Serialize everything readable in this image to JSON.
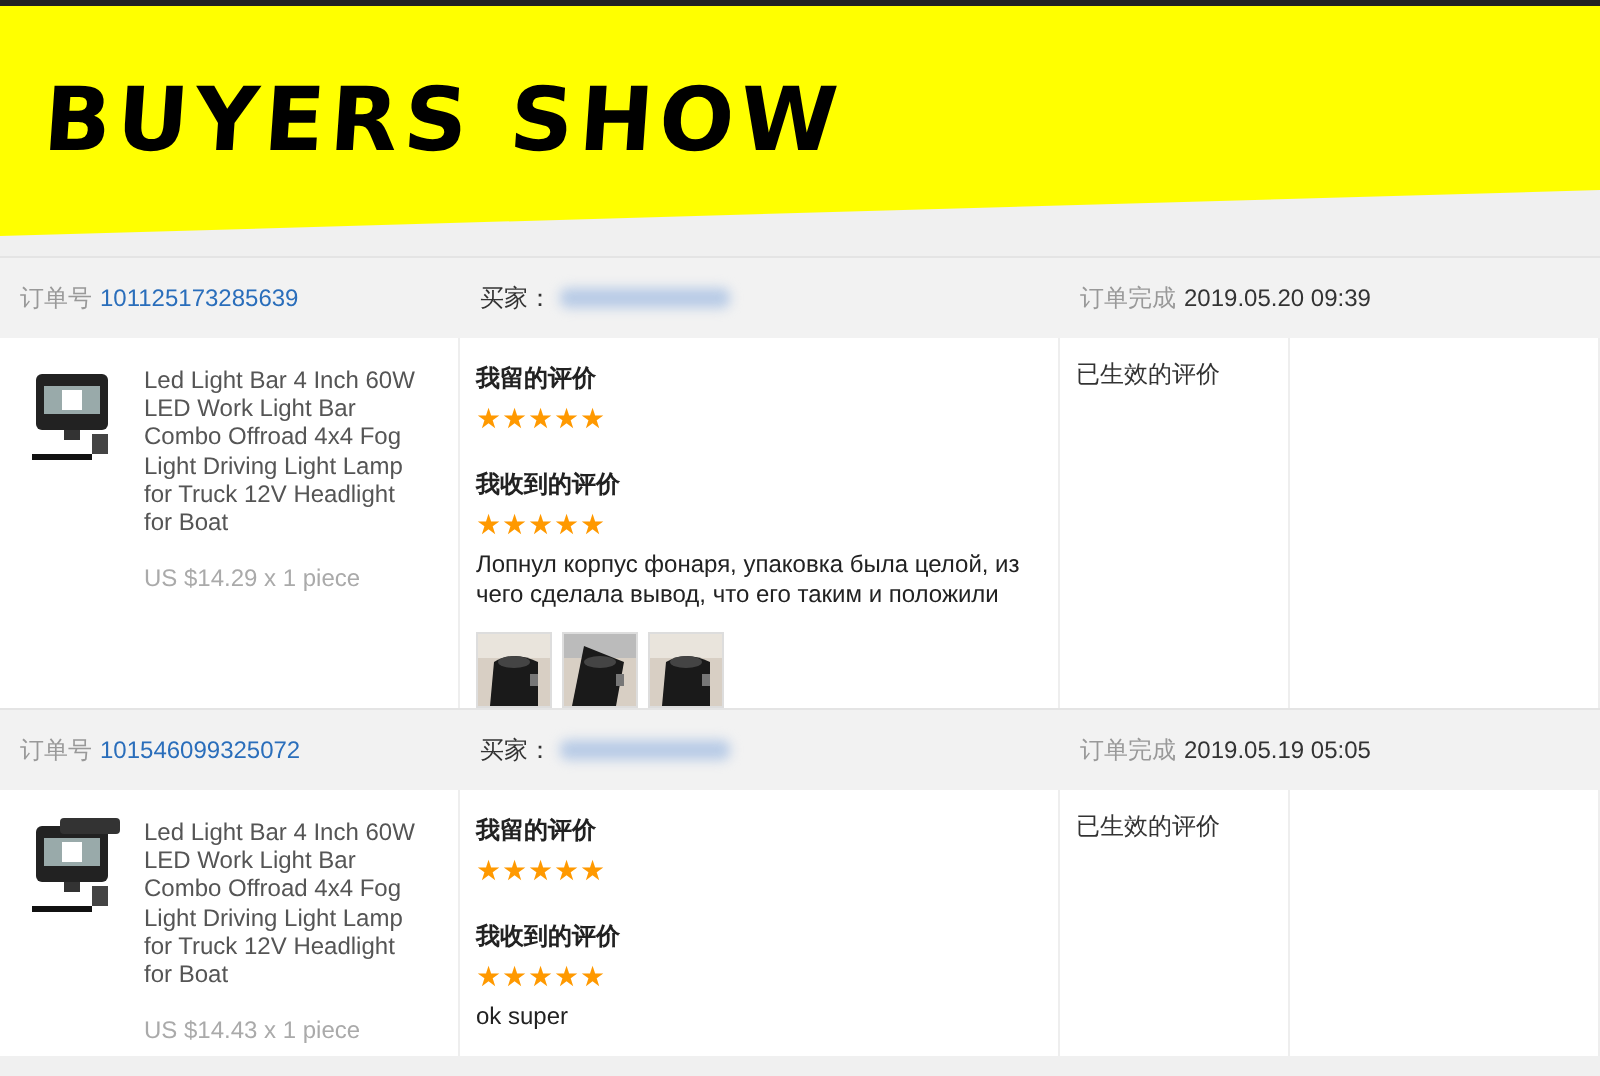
{
  "banner": {
    "title": "BUYERS SHOW"
  },
  "orders": [
    {
      "order_label": "订单号",
      "order_number": "101125173285639",
      "buyer_label": "买家：",
      "completed_label": "订单完成",
      "completed_time": "2019.05.20 09:39",
      "product": {
        "image": {
          "kind": "picture"
        },
        "title": "Led Light Bar 4 Inch 60W LED Work Light Bar Combo Offroad 4x4 Fog Light Driving Light Lamp for Truck 12V Headlight for Boat",
        "price": "US $14.29 x 1 piece"
      },
      "reviews": [
        {
          "heading": "我留的评价",
          "stars": 5
        },
        {
          "heading": "我收到的评价",
          "stars": 5,
          "comment": "Лопнул корпус фонаря, упаковка была целой, из чего сделала вывод, что его таким и положили",
          "photos": [
            {
              "kind": "picture"
            },
            {
              "kind": "picture"
            },
            {
              "kind": "picture"
            }
          ]
        }
      ],
      "status": "已生效的评价"
    },
    {
      "order_label": "订单号",
      "order_number": "101546099325072",
      "buyer_label": "买家：",
      "completed_label": "订单完成",
      "completed_time": "2019.05.19 05:05",
      "product": {
        "image": {
          "kind": "picture"
        },
        "title": "Led Light Bar 4 Inch 60W LED Work Light Bar Combo Offroad 4x4 Fog Light Driving Light Lamp for Truck 12V Headlight for Boat",
        "price": "US $14.43 x 1 piece"
      },
      "reviews": [
        {
          "heading": "我留的评价",
          "stars": 5
        },
        {
          "heading": "我收到的评价",
          "stars": 5,
          "comment": "ok super"
        }
      ],
      "status": "已生效的评价"
    }
  ]
}
